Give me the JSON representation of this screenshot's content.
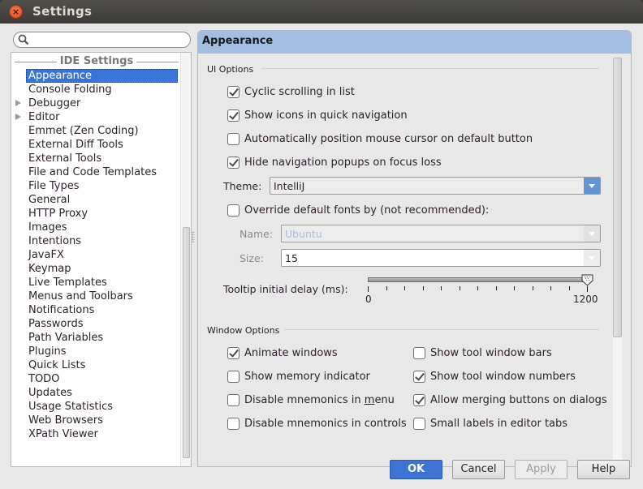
{
  "window": {
    "title": "Settings"
  },
  "search": {
    "value": "",
    "placeholder": ""
  },
  "tree": {
    "header": "IDE Settings",
    "items": [
      {
        "label": "Appearance",
        "selected": true,
        "expandable": false
      },
      {
        "label": "Console Folding",
        "expandable": false
      },
      {
        "label": "Debugger",
        "expandable": true
      },
      {
        "label": "Editor",
        "expandable": true
      },
      {
        "label": "Emmet (Zen Coding)",
        "expandable": false
      },
      {
        "label": "External Diff Tools",
        "expandable": false
      },
      {
        "label": "External Tools",
        "expandable": false
      },
      {
        "label": "File and Code Templates",
        "expandable": false
      },
      {
        "label": "File Types",
        "expandable": false
      },
      {
        "label": "General",
        "expandable": false
      },
      {
        "label": "HTTP Proxy",
        "expandable": false
      },
      {
        "label": "Images",
        "expandable": false
      },
      {
        "label": "Intentions",
        "expandable": false
      },
      {
        "label": "JavaFX",
        "expandable": false
      },
      {
        "label": "Keymap",
        "expandable": false
      },
      {
        "label": "Live Templates",
        "expandable": false
      },
      {
        "label": "Menus and Toolbars",
        "expandable": false
      },
      {
        "label": "Notifications",
        "expandable": false
      },
      {
        "label": "Passwords",
        "expandable": false
      },
      {
        "label": "Path Variables",
        "expandable": false
      },
      {
        "label": "Plugins",
        "expandable": false
      },
      {
        "label": "Quick Lists",
        "expandable": false
      },
      {
        "label": "TODO",
        "expandable": false
      },
      {
        "label": "Updates",
        "expandable": false
      },
      {
        "label": "Usage Statistics",
        "expandable": false
      },
      {
        "label": "Web Browsers",
        "expandable": false
      },
      {
        "label": "XPath Viewer",
        "expandable": false
      }
    ]
  },
  "panel": {
    "title": "Appearance",
    "ui_options": {
      "title": "UI Options",
      "cyclic_scrolling": {
        "label": "Cyclic scrolling in list",
        "checked": true
      },
      "show_icons": {
        "label": "Show icons in quick navigation",
        "checked": true
      },
      "auto_position_mouse": {
        "label": "Automatically position mouse cursor on default button",
        "checked": false
      },
      "hide_nav_popups": {
        "label": "Hide navigation popups on focus loss",
        "checked": true
      },
      "theme_label": "Theme:",
      "theme_value": "IntelliJ",
      "override_fonts": {
        "label": "Override default fonts by (not recommended):",
        "checked": false
      },
      "name_label": "Name:",
      "name_value": "Ubuntu",
      "size_label": "Size:",
      "size_value": "15",
      "tooltip_label": "Tooltip initial delay (ms):",
      "tooltip_min": "0",
      "tooltip_max": "1200",
      "tooltip_value": 1200
    },
    "window_options": {
      "title": "Window Options",
      "animate_windows": {
        "label": "Animate windows",
        "checked": true
      },
      "show_memory": {
        "label": "Show memory indicator",
        "checked": false
      },
      "disable_mnemonics_menu": {
        "label_prefix": "Disable mnemonics in ",
        "label_mnemonic": "m",
        "label_suffix": "enu",
        "checked": false
      },
      "disable_mnemonics_controls": {
        "label": "Disable mnemonics in controls",
        "checked": false
      },
      "show_tool_window_bars": {
        "label": "Show tool window bars",
        "checked": false
      },
      "show_tool_window_numbers": {
        "label": "Show tool window numbers",
        "checked": true
      },
      "allow_merging_buttons": {
        "label": "Allow merging buttons on dialogs",
        "checked": true
      },
      "small_labels": {
        "label": "Small labels in editor tabs",
        "checked": false
      }
    }
  },
  "buttons": {
    "ok": "OK",
    "cancel": "Cancel",
    "apply": "Apply",
    "help": "Help"
  },
  "colors": {
    "accent": "#3875d7",
    "header": "#a4bde2",
    "ok_button": "#3d73d2",
    "close_button": "#df4a16"
  }
}
